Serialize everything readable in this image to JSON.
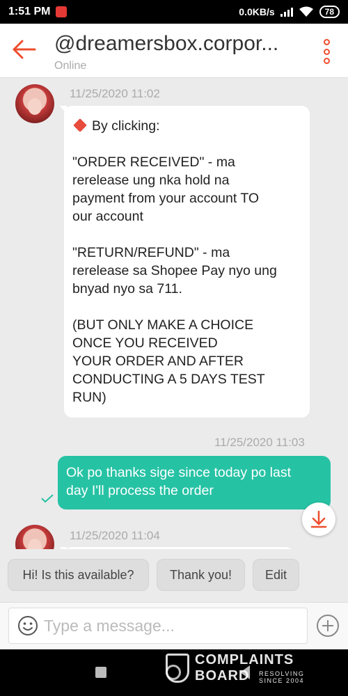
{
  "status_bar": {
    "time": "1:51 PM",
    "network": "0.0KB/s",
    "battery": "78"
  },
  "header": {
    "title": "@dreamersbox.corpor...",
    "status": "Online"
  },
  "messages": [
    {
      "direction": "incoming",
      "timestamp": "11/25/2020 11:02",
      "lines": [
        "By clicking:",
        "",
        "\"ORDER RECEIVED\" - ma",
        "rerelease ung nka hold na",
        "payment from your account TO",
        "our account",
        "",
        "\"RETURN/REFUND\" - ma",
        "rerelease sa Shopee Pay nyo ung",
        "bnyad nyo sa 711.",
        "",
        "(BUT ONLY MAKE A CHOICE",
        "ONCE YOU RECEIVED",
        "YOUR ORDER AND AFTER",
        "CONDUCTING A 5 DAYS TEST",
        "RUN)"
      ]
    },
    {
      "direction": "outgoing",
      "timestamp": "11/25/2020 11:03",
      "lines": [
        "Ok po thanks sige since today po last",
        "day I'll process the order"
      ]
    },
    {
      "direction": "incoming",
      "timestamp": "11/25/2020 11:04",
      "lines": []
    }
  ],
  "quick_replies": [
    "Hi! Is this available?",
    "Thank you!",
    "Edit"
  ],
  "composer": {
    "placeholder": "Type a message..."
  },
  "watermark": {
    "line1": "COMPLAINTS",
    "line2": "BOARD",
    "tag1": "RESOLVING",
    "tag2": "SINCE 2004"
  },
  "colors": {
    "brand": "#ee4d2d",
    "outgoing_bubble": "#26c2a4",
    "background": "#ebebeb"
  },
  "icons": {
    "back": "arrow-left-icon",
    "menu": "more-vertical-icon",
    "scroll_down": "arrow-down-icon",
    "emoji": "smiley-icon",
    "attach": "plus-circle-icon",
    "delivered": "check-icon"
  }
}
